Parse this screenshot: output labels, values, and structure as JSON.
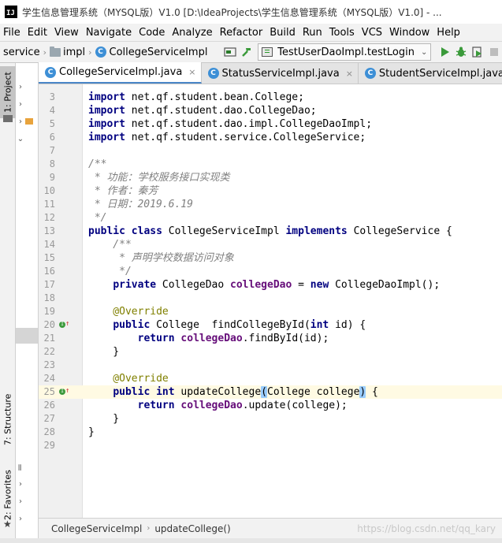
{
  "window": {
    "title": "学生信息管理系统（MYSQL版）V1.0 [D:\\IdeaProjects\\学生信息管理系统（MYSQL版）V1.0] - ..."
  },
  "menu": [
    "File",
    "Edit",
    "View",
    "Navigate",
    "Code",
    "Analyze",
    "Refactor",
    "Build",
    "Run",
    "Tools",
    "VCS",
    "Window",
    "Help"
  ],
  "breadcrumbs": {
    "items": [
      "service",
      "impl",
      "CollegeServiceImpl"
    ]
  },
  "run_config": {
    "label": "TestUserDaoImpl.testLogin"
  },
  "left_tabs": {
    "project": "1: Project",
    "structure": "7: Structure",
    "favorites": "2: Favorites"
  },
  "tabs": [
    {
      "label": "CollegeServiceImpl.java",
      "active": true
    },
    {
      "label": "StatusServiceImpl.java",
      "active": false
    },
    {
      "label": "StudentServiceImpl.java",
      "active": false
    }
  ],
  "code": {
    "lines": [
      {
        "n": "3",
        "text": "import net.qf.student.bean.College;"
      },
      {
        "n": "4",
        "text": "import net.qf.student.dao.CollegeDao;"
      },
      {
        "n": "5",
        "text": "import net.qf.student.dao.impl.CollegeDaoImpl;"
      },
      {
        "n": "6",
        "text": "import net.qf.student.service.CollegeService;"
      },
      {
        "n": "7",
        "text": ""
      },
      {
        "n": "8",
        "text": "/**"
      },
      {
        "n": "9",
        "text": " * 功能：学校服务接口实现类"
      },
      {
        "n": "10",
        "text": " * 作者：秦芳"
      },
      {
        "n": "11",
        "text": " * 日期：2019.6.19"
      },
      {
        "n": "12",
        "text": " */"
      },
      {
        "n": "13",
        "text": "public class CollegeServiceImpl implements CollegeService {"
      },
      {
        "n": "14",
        "text": "    /**"
      },
      {
        "n": "15",
        "text": "     * 声明学校数据访问对象"
      },
      {
        "n": "16",
        "text": "     */"
      },
      {
        "n": "17",
        "text": "    private CollegeDao collegeDao = new CollegeDaoImpl();"
      },
      {
        "n": "18",
        "text": ""
      },
      {
        "n": "19",
        "text": "    @Override"
      },
      {
        "n": "20",
        "text": "    public College  findCollegeById(int id) {"
      },
      {
        "n": "21",
        "text": "        return collegeDao.findById(id);"
      },
      {
        "n": "22",
        "text": "    }"
      },
      {
        "n": "23",
        "text": ""
      },
      {
        "n": "24",
        "text": "    @Override"
      },
      {
        "n": "25",
        "text": "    public int updateCollege(College college) {"
      },
      {
        "n": "26",
        "text": "        return collegeDao.update(college);"
      },
      {
        "n": "27",
        "text": "    }"
      },
      {
        "n": "28",
        "text": "}"
      },
      {
        "n": "29",
        "text": ""
      }
    ]
  },
  "status": {
    "crumb_class": "CollegeServiceImpl",
    "crumb_method": "updateCollege()",
    "watermark": "https://blog.csdn.net/qq_kary"
  },
  "icons": {
    "build": "hammer-icon",
    "run": "play-icon",
    "debug": "bug-icon",
    "coverage": "coverage-icon",
    "stop": "stop-icon"
  },
  "colors": {
    "keyword": "#000080",
    "comment": "#808080",
    "field": "#660e7a",
    "annotation": "#808000",
    "caret_line": "#fffae3",
    "run_green": "#3a9a3a"
  }
}
